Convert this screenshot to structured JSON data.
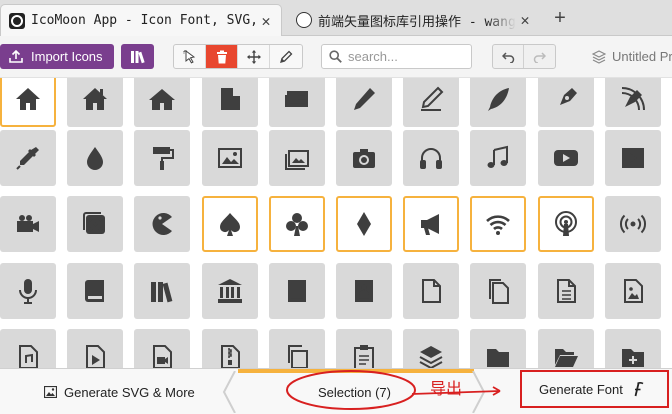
{
  "browser": {
    "tabs": [
      {
        "title": "IcoMoon App - Icon Font, SVG, PDF & PNG Generator",
        "active": true
      },
      {
        "title": "前端矢量图标库引用操作 - wang_q",
        "active": false
      }
    ],
    "close_glyph": "✕",
    "new_tab_glyph": "+"
  },
  "toolbar": {
    "import_label": "Import Icons",
    "library_icon": "library-icon",
    "modes": [
      "select-icon",
      "delete-icon",
      "move-icon",
      "edit-icon"
    ],
    "active_mode": "delete-icon",
    "search_placeholder": "search...",
    "project_name": "Untitled Project"
  },
  "grid": {
    "rows": [
      [
        "home",
        "home2",
        "home3",
        "office",
        "newspaper",
        "pencil",
        "pencil2",
        "quill",
        "pen",
        "blog"
      ],
      [
        "eyedropper",
        "droplet",
        "paint-format",
        "image",
        "images",
        "camera",
        "headphones",
        "music",
        "play",
        "film"
      ],
      [
        "video-camera",
        "dice",
        "pacman",
        "spades",
        "clubs",
        "diamonds",
        "bullhorn",
        "connection",
        "podcast",
        "feed"
      ],
      [
        "mic",
        "book",
        "books",
        "library",
        "file-text",
        "profile",
        "file-empty",
        "files-empty",
        "file-text2",
        "file-picture"
      ],
      [
        "file-music",
        "file-play",
        "file-video",
        "file-zip",
        "copy",
        "paste",
        "stack",
        "folder",
        "folder-open",
        "folder-plus"
      ]
    ],
    "selected": [
      "home",
      "spades",
      "clubs",
      "diamonds",
      "bullhorn",
      "connection",
      "podcast"
    ],
    "accent": "#f6b23e"
  },
  "bottom": {
    "generate_svg_label": "Generate SVG & More",
    "selection_label": "Selection (7)",
    "annotation_text": "导出",
    "generate_font_label": "Generate Font",
    "annotation_color": "#d82020"
  }
}
